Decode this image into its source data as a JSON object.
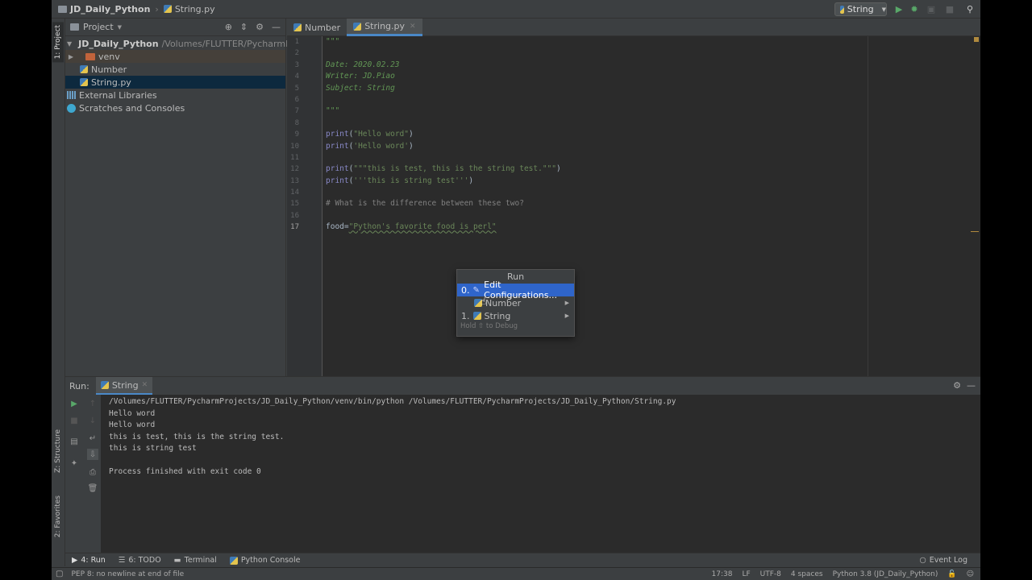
{
  "navbar": {
    "project": "JD_Daily_Python",
    "file": "String.py",
    "run_config": "String",
    "run_icon": "play-icon",
    "debug_icon": "bug-icon",
    "search_icon": "search-icon"
  },
  "left_stripe": {
    "project_tab": "1: Project",
    "structure_tab": "Z: Structure",
    "favorites_tab": "2: Favorites"
  },
  "project_panel": {
    "title": "Project",
    "root_name": "JD_Daily_Python",
    "root_path": "/Volumes/FLUTTER/PycharmPro",
    "items": [
      {
        "label": "venv"
      },
      {
        "label": "Number"
      },
      {
        "label": "String.py"
      }
    ],
    "external_libraries": "External Libraries",
    "scratches": "Scratches and Consoles"
  },
  "editor": {
    "tabs": [
      {
        "label": "Number"
      },
      {
        "label": "String.py"
      }
    ],
    "line_numbers": [
      "1",
      "2",
      "3",
      "4",
      "5",
      "6",
      "7",
      "8",
      "9",
      "10",
      "11",
      "12",
      "13",
      "14",
      "15",
      "16",
      "17"
    ],
    "lines": [
      "\"\"\"",
      "",
      "Date: 2020.02.23",
      "Writer: JD.Piao",
      "Subject: String",
      "",
      "\"\"\"",
      "",
      "print(\"Hello word\")",
      "print('Hello word')",
      "",
      "print(\"\"\"this is test, this is the string test.\"\"\")",
      "print('''this is string test''')",
      "",
      "# What is the difference between these two?",
      "",
      "food=\"Python's favorite food is perl\""
    ]
  },
  "popup": {
    "title": "Run",
    "items": [
      {
        "index": "0.",
        "label": "Edit Configurations..."
      },
      {
        "index": "",
        "label": "Number"
      },
      {
        "index": "1.",
        "label": "String"
      }
    ],
    "hint": "Hold ⇧ to Debug"
  },
  "run_panel": {
    "label": "Run:",
    "tab": "String",
    "console": [
      "/Volumes/FLUTTER/PycharmProjects/JD_Daily_Python/venv/bin/python /Volumes/FLUTTER/PycharmProjects/JD_Daily_Python/String.py",
      "Hello word",
      "Hello word",
      "this is test, this is the string test.",
      "this is string test",
      "",
      "Process finished with exit code 0"
    ]
  },
  "bottom_tools": {
    "run": "4: Run",
    "todo": "6: TODO",
    "terminal": "Terminal",
    "python_console": "Python Console",
    "event_log": "Event Log"
  },
  "status": {
    "message": "PEP 8: no newline at end of file",
    "position": "17:38",
    "line_sep": "LF",
    "encoding": "UTF-8",
    "indent": "4 spaces",
    "interpreter": "Python 3.8 (JD_Daily_Python)"
  }
}
